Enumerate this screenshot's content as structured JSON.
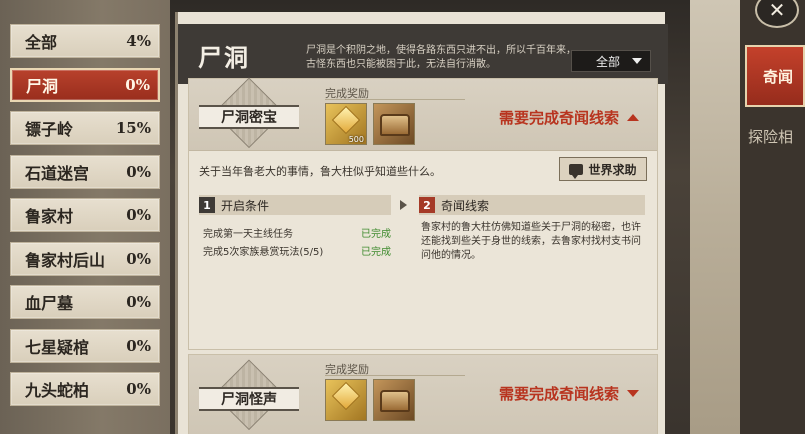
{
  "sidebar": {
    "items": [
      {
        "label": "全部",
        "pct": "4%"
      },
      {
        "label": "尸洞",
        "pct": "0%"
      },
      {
        "label": "镖子岭",
        "pct": "15%"
      },
      {
        "label": "石道迷宫",
        "pct": "0%"
      },
      {
        "label": "鲁家村",
        "pct": "0%"
      },
      {
        "label": "鲁家村后山",
        "pct": "0%"
      },
      {
        "label": "血尸墓",
        "pct": "0%"
      },
      {
        "label": "七星疑棺",
        "pct": "0%"
      },
      {
        "label": "九头蛇柏",
        "pct": "0%"
      }
    ]
  },
  "header": {
    "title": "尸洞",
    "desc": "尸洞是个积阴之地，使得各路东西只进不出，所以千百年来，古怪东西也只能被困于此，无法自行消散。",
    "filter": "全部"
  },
  "card1": {
    "badge": "尸洞密宝",
    "reward_label": "完成奖励",
    "reward_count": "500",
    "need": "需要完成奇闻线索",
    "intro": "关于当年鲁老大的事情，鲁大柱似乎知道些什么。",
    "world_help": "世界求助",
    "sec1_num": "1",
    "sec1_title": "开启条件",
    "sec2_num": "2",
    "sec2_title": "奇闻线索",
    "conditions": [
      {
        "text": "完成第一天主线任务",
        "status": "已完成"
      },
      {
        "text": "完成5次家族悬赏玩法(5/5)",
        "status": "已完成"
      }
    ],
    "clue": "鲁家村的鲁大柱仿佛知道些关于尸洞的秘密，也许还能找到些关于身世的线索，去鲁家村找村支书问问他的情况。"
  },
  "card2": {
    "badge": "尸洞怪声",
    "reward_label": "完成奖励",
    "need": "需要完成奇闻线索"
  },
  "right": {
    "close": "✕",
    "tab_active": "奇闻",
    "tab_other": "探险相"
  }
}
